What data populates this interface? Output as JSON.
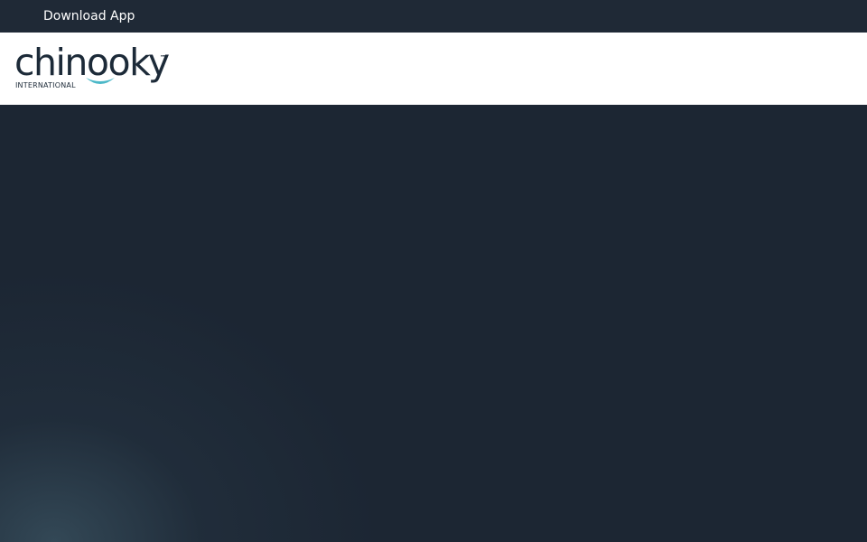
{
  "topbar": {
    "download_label": "Download App"
  },
  "logo": {
    "wordmark": "chinooky",
    "trademark": "™",
    "subtitle": "INTERNATIONAL"
  },
  "colors": {
    "topbar_bg": "#1f2936",
    "header_bg": "#ffffff",
    "hero_bg": "#1c2633",
    "logo_text": "#1c2a38",
    "logo_accent": "#4bb8c8"
  },
  "icons": {
    "logo_smile": "smile-swoosh-icon"
  }
}
